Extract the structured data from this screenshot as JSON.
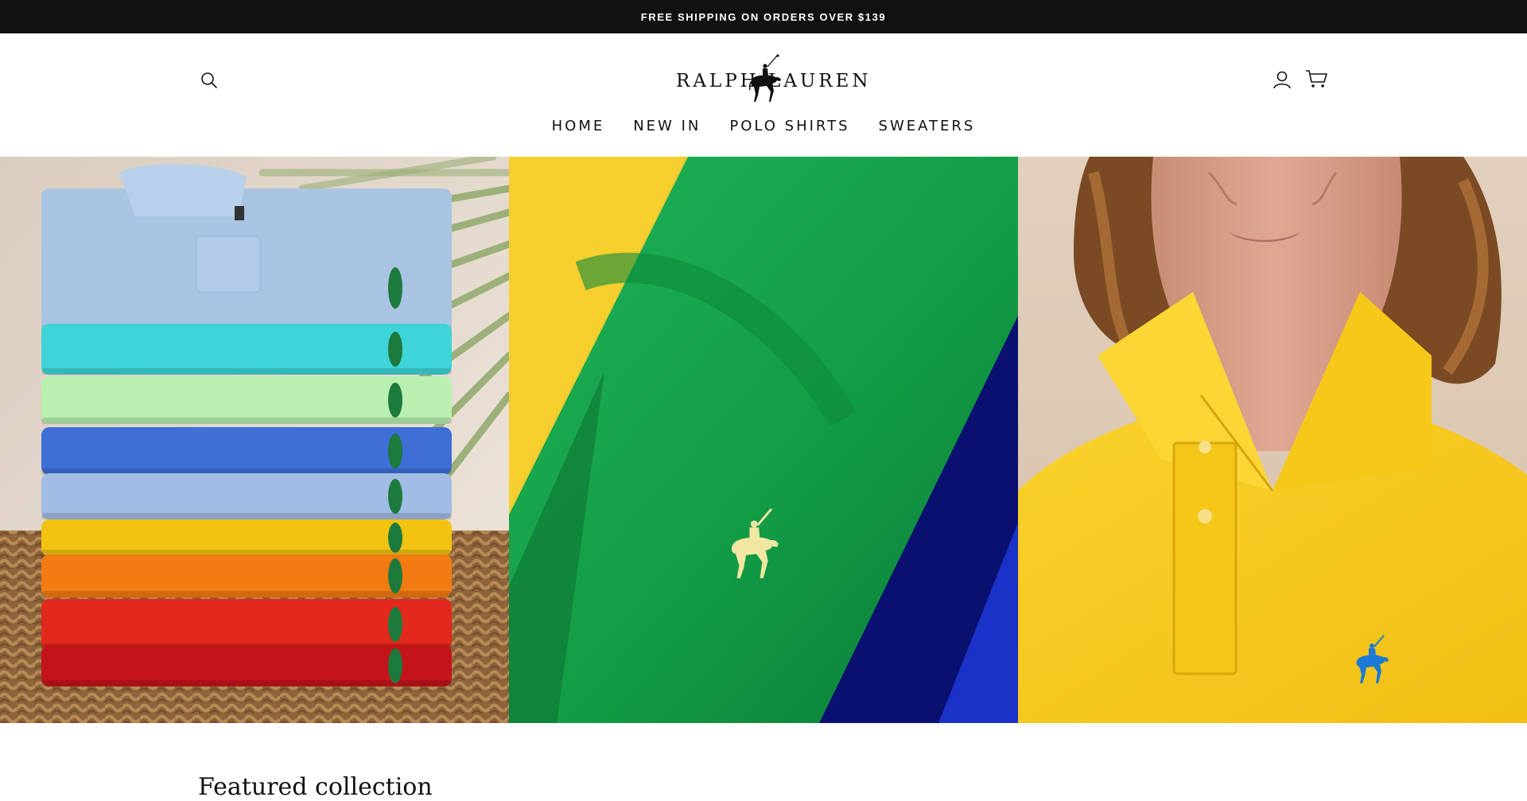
{
  "announcement": {
    "text": "FREE SHIPPING ON ORDERS OVER $139"
  },
  "header": {
    "logo_text": "RALPH LAUREN",
    "icons": {
      "search": "search-icon",
      "account": "account-icon",
      "cart": "cart-icon"
    }
  },
  "nav": {
    "items": [
      {
        "label": "HOME"
      },
      {
        "label": "NEW IN"
      },
      {
        "label": "POLO SHIRTS"
      },
      {
        "label": "SWEATERS"
      }
    ]
  },
  "hero": {
    "panels": [
      {
        "name": "stacked polo shirts"
      },
      {
        "name": "green polo close-up"
      },
      {
        "name": "model in yellow polo"
      }
    ],
    "colors": {
      "stack": [
        "#a9c4e3",
        "#3ed4d8",
        "#b9f0b0",
        "#3f6fd6",
        "#a2bde5",
        "#f3c312",
        "#f37b12",
        "#e3291c",
        "#c4141b"
      ],
      "green": "#17a04c",
      "yellow": "#f9d02c",
      "navy": "#0a1270",
      "pony_green": "#1c7a3d",
      "pony_blue": "#1a7ad6",
      "pony_cream": "#f1e7a2"
    }
  },
  "featured": {
    "title": "Featured collection"
  }
}
